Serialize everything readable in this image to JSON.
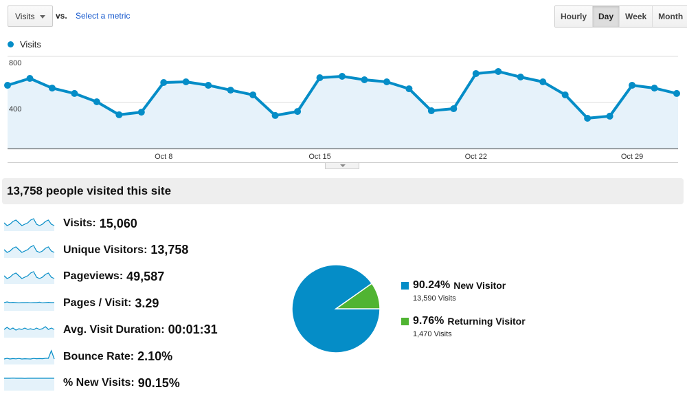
{
  "toolbar": {
    "metric_select": "Visits",
    "vs_label": "vs.",
    "select_metric_link": "Select a metric",
    "range_buttons": [
      {
        "label": "Hourly",
        "active": false
      },
      {
        "label": "Day",
        "active": true
      },
      {
        "label": "Week",
        "active": false
      },
      {
        "label": "Month",
        "active": false
      }
    ]
  },
  "legend": {
    "label": "Visits",
    "color": "#058dc7"
  },
  "chart_data": {
    "type": "area",
    "title": "",
    "series": [
      {
        "name": "Visits",
        "color": "#058dc7",
        "values": [
          549,
          609,
          525,
          478,
          406,
          293,
          316,
          573,
          579,
          549,
          507,
          466,
          287,
          322,
          615,
          627,
          597,
          579,
          519,
          328,
          346,
          651,
          669,
          621,
          579,
          466,
          263,
          281,
          549,
          525,
          478
        ]
      }
    ],
    "x": [
      "Oct 1",
      "Oct 2",
      "Oct 3",
      "Oct 4",
      "Oct 5",
      "Oct 6",
      "Oct 7",
      "Oct 8",
      "Oct 9",
      "Oct 10",
      "Oct 11",
      "Oct 12",
      "Oct 13",
      "Oct 14",
      "Oct 15",
      "Oct 16",
      "Oct 17",
      "Oct 18",
      "Oct 19",
      "Oct 20",
      "Oct 21",
      "Oct 22",
      "Oct 23",
      "Oct 24",
      "Oct 25",
      "Oct 26",
      "Oct 27",
      "Oct 28",
      "Oct 29",
      "Oct 30",
      "Oct 31"
    ],
    "x_tick_labels": [
      {
        "index": 7,
        "label": "Oct 8"
      },
      {
        "index": 14,
        "label": "Oct 15"
      },
      {
        "index": 21,
        "label": "Oct 22"
      },
      {
        "index": 28,
        "label": "Oct 29"
      }
    ],
    "y_ticks": [
      {
        "value": 400,
        "label": "400"
      },
      {
        "value": 800,
        "label": "800"
      }
    ],
    "ylim": [
      0,
      800
    ],
    "grid": true,
    "xlabel": "",
    "ylabel": ""
  },
  "summary": {
    "headline": "13,758 people visited this site"
  },
  "metrics": [
    {
      "label": "Visits:",
      "value": "15,060",
      "spark": [
        5,
        3,
        4,
        6,
        7,
        5,
        3,
        4,
        5,
        7,
        8,
        4,
        3,
        4,
        6,
        7,
        4,
        3
      ]
    },
    {
      "label": "Unique Visitors:",
      "value": "13,758",
      "spark": [
        5,
        3,
        4,
        6,
        7,
        5,
        3,
        4,
        5,
        7,
        8,
        4,
        3,
        4,
        6,
        7,
        4,
        3
      ]
    },
    {
      "label": "Pageviews:",
      "value": "49,587",
      "spark": [
        5,
        3,
        4,
        6,
        7,
        5,
        3,
        4,
        5,
        7,
        8,
        4,
        3,
        4,
        6,
        7,
        4,
        3
      ]
    },
    {
      "label": "Pages / Visit:",
      "value": "3.29",
      "spark": [
        5,
        5.5,
        5,
        5.2,
        5,
        4.8,
        5,
        5,
        5.1,
        4.9,
        5,
        5,
        5.3,
        4.8,
        5,
        5.2,
        5,
        5
      ]
    },
    {
      "label": "Avg. Visit Duration:",
      "value": "00:01:31",
      "spark": [
        5,
        6.5,
        5,
        6,
        4.5,
        5.5,
        5,
        6,
        5,
        5.5,
        4.8,
        6,
        5,
        5.5,
        7,
        5,
        6,
        5
      ]
    },
    {
      "label": "Bounce Rate:",
      "value": "2.10%",
      "spark": [
        3,
        3.5,
        3,
        3.3,
        3.1,
        3.4,
        3,
        3.2,
        3.1,
        3,
        3.4,
        3.2,
        3.3,
        3.2,
        3.5,
        3.5,
        9,
        3
      ]
    },
    {
      "label": "% New Visits:",
      "value": "90.15%",
      "spark": [
        8,
        8,
        8,
        8.1,
        8,
        8,
        8,
        7.9,
        8,
        8,
        8,
        8,
        8,
        8,
        8,
        8,
        8,
        8
      ]
    }
  ],
  "pie": {
    "slices": [
      {
        "label": "New Visitor",
        "percent": 90.24,
        "percent_label": "90.24%",
        "visits": "13,590 Visits",
        "color": "#058dc7"
      },
      {
        "label": "Returning Visitor",
        "percent": 9.76,
        "percent_label": "9.76%",
        "visits": "1,470 Visits",
        "color": "#50b432"
      }
    ]
  }
}
